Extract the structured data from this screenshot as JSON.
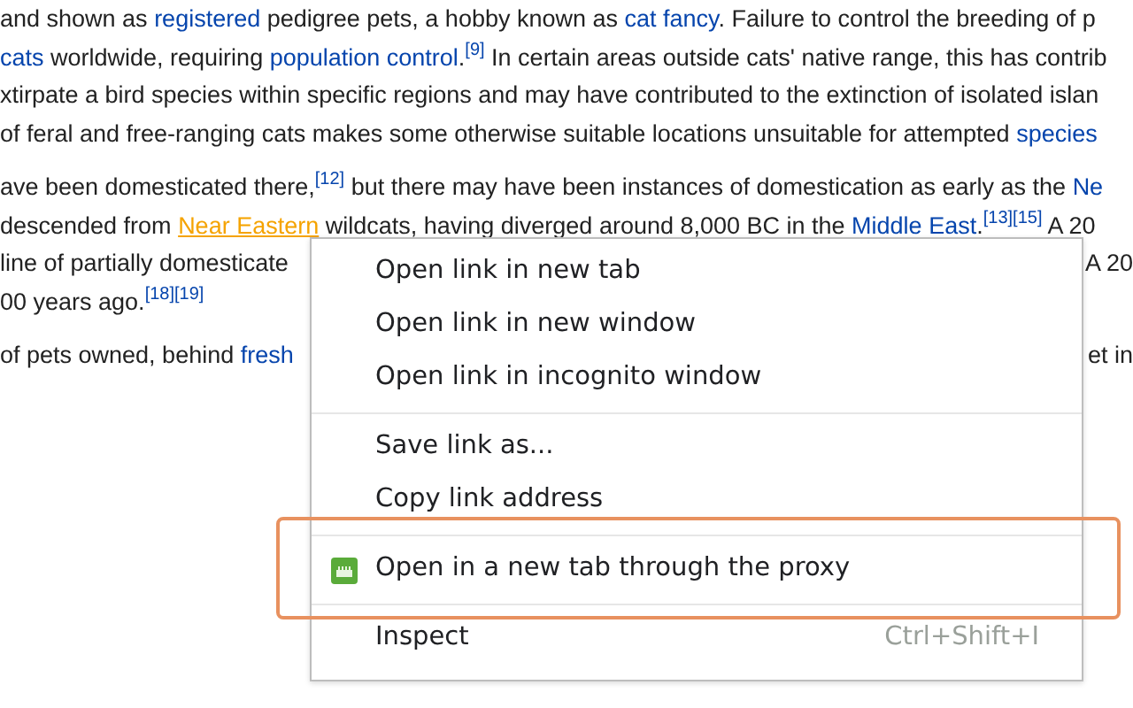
{
  "article": {
    "paragraphs": [
      {
        "lines": [
          {
            "left": [
              {
                "kind": "text",
                "text": "and shown as "
              },
              {
                "kind": "link",
                "text": "registered"
              },
              {
                "kind": "text",
                "text": " pedigree pets, a hobby known as "
              },
              {
                "kind": "link",
                "text": "cat fancy"
              },
              {
                "kind": "text",
                "text": ". Failure to control the breeding of p"
              }
            ]
          },
          {
            "left": [
              {
                "kind": "link",
                "text": "cats"
              },
              {
                "kind": "text",
                "text": " worldwide, requiring "
              },
              {
                "kind": "link",
                "text": "population control"
              },
              {
                "kind": "text",
                "text": ".",
                "ref": "[9]"
              },
              {
                "kind": "text",
                "text": " In certain areas outside cats' native range, this has contrib"
              }
            ]
          },
          {
            "left": [
              {
                "kind": "text",
                "text": "xtirpate a bird species within specific regions and may have contributed to the extinction of isolated islan"
              }
            ]
          },
          {
            "left": [
              {
                "kind": "text",
                "text": "of feral and free-ranging cats makes some otherwise suitable locations unsuitable for attempted "
              },
              {
                "kind": "link",
                "text": "species"
              }
            ]
          }
        ]
      },
      {
        "lines": [
          {
            "left": [
              {
                "kind": "text",
                "text": "ave been domesticated there,"
              },
              {
                "kind": "ref",
                "text": "[12]"
              },
              {
                "kind": "text",
                "text": " but there may have been instances of domestication as early as the "
              },
              {
                "kind": "link",
                "text": "Ne"
              }
            ]
          },
          {
            "left": [
              {
                "kind": "text",
                "text": "descended from "
              },
              {
                "kind": "hover",
                "text": "Near Eastern"
              },
              {
                "kind": "text",
                "text": " wildcats, having diverged around 8,000 BC in the "
              },
              {
                "kind": "link",
                "text": "Middle East"
              },
              {
                "kind": "text",
                "text": ".",
                "ref": "[13][15]"
              },
              {
                "kind": "text",
                "text": " A 20"
              }
            ]
          },
          {
            "left": [
              {
                "kind": "text",
                "text": "line of partially domesticate"
              }
            ],
            "right": [
              {
                "kind": "text",
                "text": "A 20"
              }
            ]
          },
          {
            "left": [
              {
                "kind": "text",
                "text": "00 years ago."
              },
              {
                "kind": "ref",
                "text": "[18][19]"
              }
            ]
          }
        ]
      },
      {
        "lines": [
          {
            "left": [
              {
                "kind": "text",
                "text": "of pets owned, behind "
              },
              {
                "kind": "link",
                "text": "fresh"
              }
            ],
            "right": [
              {
                "kind": "text",
                "text": "et in"
              }
            ]
          }
        ]
      }
    ]
  },
  "context_menu": {
    "groups": [
      [
        {
          "label": "Open link in new tab"
        },
        {
          "label": "Open link in new window"
        },
        {
          "label": "Open link in incognito window"
        }
      ],
      [
        {
          "label": "Save link as..."
        },
        {
          "label": "Copy link address"
        }
      ],
      [
        {
          "label": "Open in a new tab through the proxy",
          "icon": true,
          "highlighted": true
        }
      ],
      [
        {
          "label": "Inspect",
          "shortcut": "Ctrl+Shift+I"
        }
      ]
    ]
  }
}
